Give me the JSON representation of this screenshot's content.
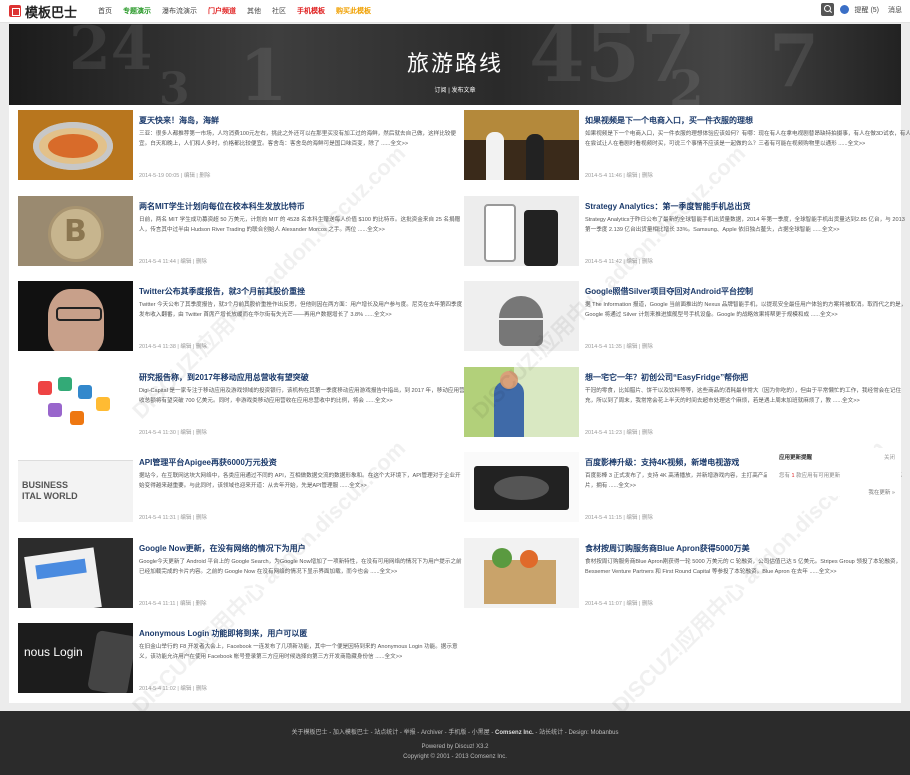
{
  "header": {
    "logo_text": "模板巴士",
    "nav": [
      {
        "label": "首页",
        "color": "#444444"
      },
      {
        "label": "专题演示",
        "color": "#2a9a2a"
      },
      {
        "label": "瀑布流演示",
        "color": "#444444"
      },
      {
        "label": "门户频道",
        "color": "#e02020"
      },
      {
        "label": "其他",
        "color": "#444444"
      },
      {
        "label": "社区",
        "color": "#444444"
      },
      {
        "label": "手机模板",
        "color": "#e02020"
      },
      {
        "label": "购买此模板",
        "color": "#f0a000"
      }
    ],
    "reminder": "提醒 (5)",
    "messages": "消息"
  },
  "banner": {
    "title": "旅游路线",
    "subscribe": "订阅",
    "publish": "发布文章"
  },
  "posts": [
    {
      "title": "夏天快来！海岛，海鲜",
      "excerpt": "三亚：很多人都推荐第一市场，人均消费100元左右，挑此之外还可以在那里买没有加工过的海鲜，然后就去自己做，这样比较便宜。白天和晚上，人们和人多时，价格都比较便宜。客舍岛：客舍岛的海鲜可是国口味百变，除了 ......全文>>",
      "date": "2014-5-19 00:05",
      "thumb": "food"
    },
    {
      "title": "如果视频是下一个电商入口，买一件衣服的理想",
      "excerpt": "如果视频是下一个电商入口，买一件衣服的理想体验应该如何？有哪：现在有人在拿电视剧替昂缺特拍摄事，有人在做3D试衣，有人在尝试让人在看剧时看视频时买，可说三个事情不应该是一起做的么？三者有可能在视频购物里以通形 ......全文>>",
      "date": "2014-5-4 11:46",
      "thumb": "shop"
    },
    {
      "title": "两名MIT学生计划向每位在校本科生发放比特币",
      "excerpt": "日前，两名 MIT 学生成功募资超 50 万美元，计划向 MIT 的 4528 名本科生赠送每人价值 $100 的比特币。这批资金来自 25 名捐赠人，传言其中过半由 Hudson River Trading 的联合创始人 Alexander Morcos 之手。两位 ......全文>>",
      "date": "2014-5-4 11:44",
      "thumb": "bitcoin"
    },
    {
      "title": "Strategy Analytics：第一季度智能手机总出货",
      "excerpt": "Strategy Analytics于昨日公布了最新的全球智能手机出货量数据，2014 年第一季度，全球智能手机出货量达到2.85 亿台，与 2013 第一季度 2.139 亿台出货量相比增长 33%。Samsung、Apple 依旧独占鳌头，占据全球智能 ......全文>>",
      "date": "2014-5-4 11:42",
      "thumb": "phones"
    },
    {
      "title": "Twitter公布其季度报告，就3个月前其股价重挫",
      "excerpt": "Twitter 今天公布了其季度报告，就3个月前其股价重挫作出反思，但他则因在两方面：用户增长及用户参与度。尼克在去年第四季度发布收入翻番，由 Twitter 首席产增长放缓而在华尔街有失光芒——再用户数据增长了 3.8% ......全文>>",
      "date": "2014-5-4 11:38",
      "thumb": "portrait"
    },
    {
      "title": "Google照借Silver项目夺回对Android平台控制",
      "excerpt": "据 The Information 报道，Google 当前面推出的 Nexus 品牌智能手机，以提现安全最佳用户体验的方案将被取消。取而代之的是，Google 将通过 Silver 计划来推进旗舰型号手机设备。Google 的战略效果将帮更于规模和成 ......全文>>",
      "date": "2014-5-4 11:35",
      "thumb": "android"
    },
    {
      "title": "研究报告称，到2017年移动应用总营收有望突破",
      "excerpt": "Digi-Capital 是一家专注于移动应用及游戏领域的投资银行，该机构在其第一季度移动应用游戏报告中指出，到 2017 年，移动应用营收总额将有望突破 700 亿美元。同时，非游戏类移动应用营收在应用总营收中的比例，将会 ......全文>>",
      "date": "2014-5-4 11:30",
      "thumb": "apps"
    },
    {
      "title": "想一宅它一年？初创公司“EasyFridge”帮你把",
      "excerpt": "干冠的零食，比如腊片、饼干以及饮料等等，这些商品的消耗最非常大（因为你吃的），但由于平常懒忙的工作，我经常会在记住充，所以到了周末，我常常会花上半天的时间去超市处理这个麻烦，若是遇上周末加班就麻烦了，教 ......全文>>",
      "date": "2014-5-4 11:23",
      "thumb": "fridge"
    },
    {
      "title": "API管理平台Apigee再获6000万元投资",
      "excerpt": "据站今，在互联网这块大网络中，各类应用通过不同的 API，互相做数据交流的数据形象和。在这个大环境下，API管理对于企业开始变得越来越重要。与此同时，该领域也迎来开道：从去年开始，先是API管理服 ......全文>>",
      "date": "2014-5-4 11:31",
      "thumb": "web"
    },
    {
      "title": "百度影棒升级：支持4K视频，新增电视游戏",
      "excerpt": "百度影棒 3 正式发布了，支持 4K 高清播放，并新增游戏内容，主打高产品形态。硬件配置方面，百度影棒采用 Amlogic S802 芯片，拥有 ......全文>>",
      "date": "2014-5-4 11:15",
      "thumb": "tv"
    },
    {
      "title": "Google Now更新，在没有网络的情况下为用户",
      "excerpt": "Google今天更新了 Android 平台上的 Google Search，为Google Now增加了一项新特性，在没有可用网络的情况下为用户提示之前已经加载完成的卡片内容。之前的 Google Now 在没有网络的情况下显示界面加载，而今也会 ......全文>>",
      "date": "2014-5-4 11:11",
      "thumb": "gnow"
    },
    {
      "title": "食材按周订购服务商Blue Apron获得5000万美",
      "excerpt": "食材按周订购服务商Blue Apron刚获得一轮 5000 万美元的 C 轮融资，公司估值已达 5 亿美元。Stripes Group 领投了本轮融资，Bessemer Venture Partners 和 First Round Capital 等参投了本轮融资。Blue Apron 在去年 ......全文>>",
      "date": "2014-5-4 11:07",
      "thumb": "box"
    },
    {
      "title": "Anonymous Login 功能即将到来，用户可以匿",
      "excerpt": "在旧金山举行的 F8 开发者大会上，Facebook 一连发布了几项新功能，其中一个便是因特到来的 Anonymous Login 功能。据示意义，该功能允许用户在使用 Facebook 帐号登录第三方应用时候选择向第三方开发商隐藏身份信 ......全文>>",
      "date": "2014-5-4 11:02",
      "thumb": "fb"
    }
  ],
  "post_actions": {
    "edit": "编辑",
    "delete": "删除"
  },
  "notice": {
    "title": "应用更新提醒",
    "close": "关闭",
    "body_prefix": "您有",
    "count": "1",
    "body_suffix": "款应用有可用更新",
    "more": "我在更新 »"
  },
  "footer": {
    "links": [
      "关于模板巴士",
      "加入模板巴士",
      "站点统计",
      "举报",
      "Archiver",
      "手机版",
      "小黑屋",
      "Comsenz Inc.",
      "站长统计",
      "Design: Mobanbus"
    ],
    "powered": "Powered by Discuz! X3.2",
    "copyright": "Copyright © 2001 - 2013 Comsenz Inc."
  },
  "watermark": "DISCUZ!应用中心 addon.discuz.com"
}
